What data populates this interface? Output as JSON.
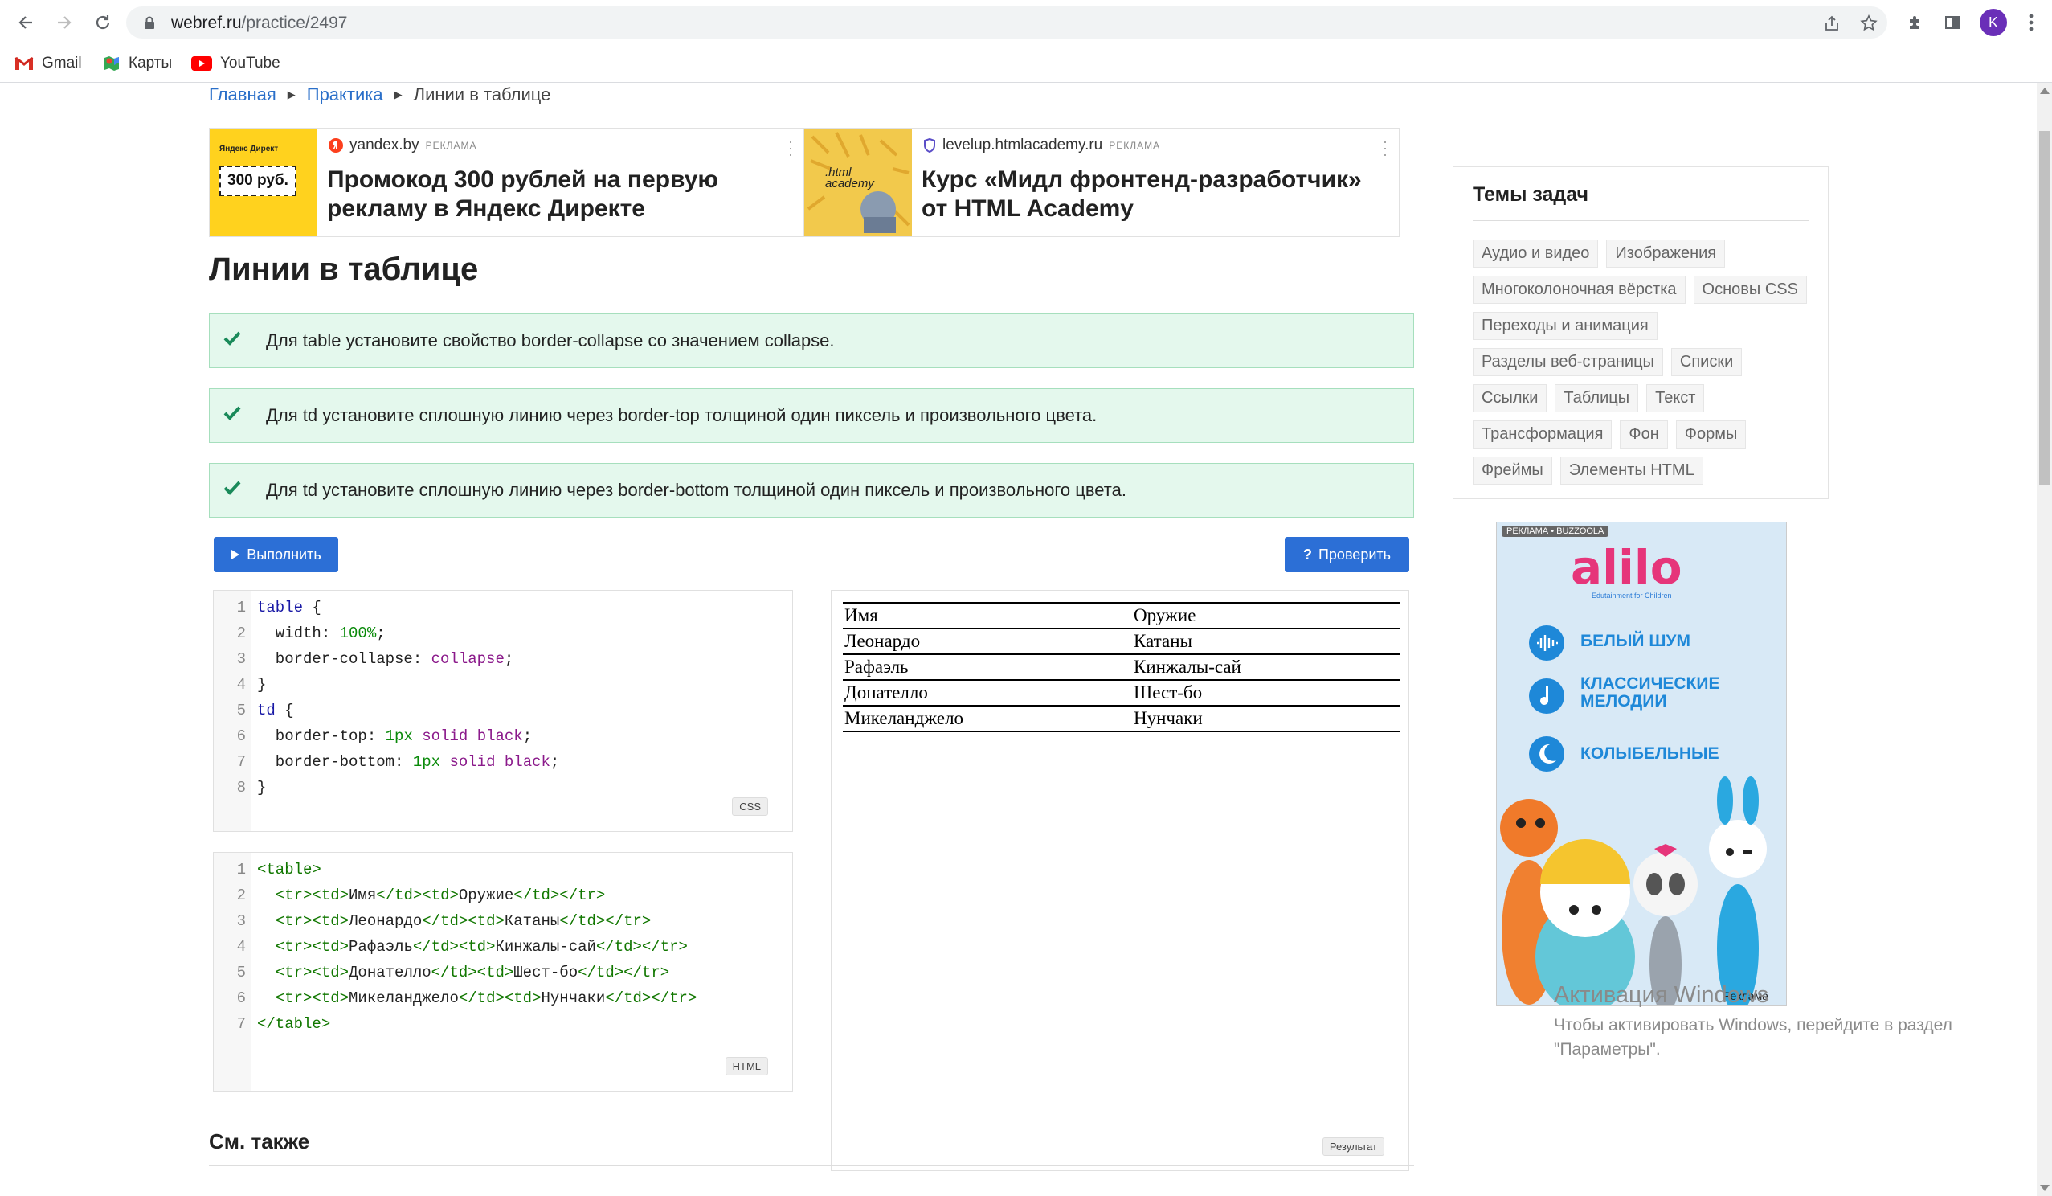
{
  "browser": {
    "url_host": "webref.ru",
    "url_path": "/practice/2497",
    "profile_initial": "K",
    "bookmarks": [
      {
        "label": "Gmail",
        "icon": "gmail-icon"
      },
      {
        "label": "Карты",
        "icon": "maps-icon"
      },
      {
        "label": "YouTube",
        "icon": "youtube-icon"
      }
    ]
  },
  "breadcrumb": [
    "Главная",
    "Практика",
    "Линии в таблице"
  ],
  "ads": [
    {
      "source": "yandex.by",
      "badge": "РЕКЛАМА",
      "title": "Промокод 300 рублей на первую рекламу в Яндекс Директе",
      "image_text": "300 руб.",
      "image_caption": "Яндекс Директ"
    },
    {
      "source": "levelup.htmlacademy.ru",
      "badge": "РЕКЛАМА",
      "title": "Курс «Мидл фронтенд-разработчик» от HTML Academy",
      "image_text": ".html academy"
    }
  ],
  "page_title": "Линии в таблице",
  "tasks": [
    "Для table установите свойство border-collapse со значением collapse.",
    "Для td установите сплошную линию через border-top толщиной один пиксель и произвольного цвета.",
    "Для td установите сплошную линию через border-bottom толщиной один пиксель и произвольного цвета."
  ],
  "buttons": {
    "run": "Выполнить",
    "check": "Проверить"
  },
  "css_label": "CSS",
  "html_label": "HTML",
  "result_label": "Результат",
  "result_table": [
    [
      "Имя",
      "Оружие"
    ],
    [
      "Леонардо",
      "Катаны"
    ],
    [
      "Рафаэль",
      "Кинжалы-сай"
    ],
    [
      "Донателло",
      "Шест-бо"
    ],
    [
      "Микеланджело",
      "Нунчаки"
    ]
  ],
  "see_also": "См. также",
  "topics": {
    "title": "Темы задач",
    "tags": [
      "Аудио и видео",
      "Изображения",
      "Многоколоночная вёрстка",
      "Основы CSS",
      "Переходы и анимация",
      "Разделы веб-страницы",
      "Списки",
      "Ссылки",
      "Таблицы",
      "Текст",
      "Трансформация",
      "Фон",
      "Формы",
      "Фреймы",
      "Элементы HTML"
    ]
  },
  "side_ad": {
    "badge": "РЕКЛАМА • BUZZOOLA",
    "brand": "alilo",
    "tagline": "Edutainment for Children",
    "items": [
      "БЕЛЫЙ ШУМ",
      "КЛАССИЧЕСКИЕ МЕЛОДИИ",
      "КОЛЫБЕЛЬНЫЕ"
    ],
    "footer": "Реклама"
  },
  "windows_watermark": {
    "title": "Активация Windows",
    "line1": "Чтобы активировать Windows, перейдите в раздел",
    "line2": "\"Параметры\"."
  }
}
